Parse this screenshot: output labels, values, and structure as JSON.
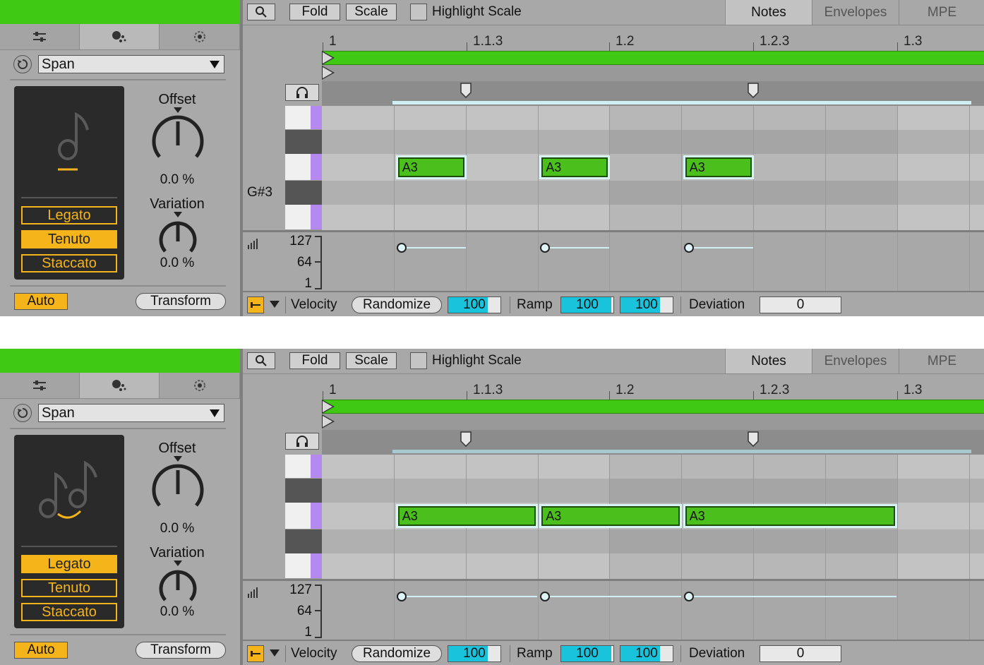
{
  "panels": [
    {
      "span_label": "Span",
      "offset": {
        "label": "Offset",
        "value": "0.0 %"
      },
      "variation": {
        "label": "Variation",
        "value": "0.0 %"
      },
      "articulation": [
        "Legato",
        "Tenuto",
        "Staccato"
      ],
      "active_articulation": "Tenuto",
      "mode": "tenuto",
      "auto_label": "Auto",
      "transform_label": "Transform",
      "toolbar": {
        "fold": "Fold",
        "scale": "Scale",
        "highlight_scale": "Highlight Scale"
      },
      "tabs": [
        "Notes",
        "Envelopes",
        "MPE"
      ],
      "active_tab": "Notes",
      "ruler": [
        "1",
        "1.1.3",
        "1.2",
        "1.2.3",
        "1.3"
      ],
      "pitch_label": "G#3",
      "notes": [
        {
          "name": "A3",
          "start_beat": 0.5,
          "length_beats": 0.5
        },
        {
          "name": "A3",
          "start_beat": 1.5,
          "length_beats": 0.5
        },
        {
          "name": "A3",
          "start_beat": 2.5,
          "length_beats": 0.5
        }
      ],
      "velocity_scale": [
        "127",
        "64",
        "1"
      ],
      "velocity_values": [
        127,
        127,
        127
      ],
      "bottom": {
        "velocity": "Velocity",
        "randomize": "Randomize",
        "velocity_value": "100",
        "ramp": "Ramp",
        "ramp_start": "100",
        "ramp_end": "100",
        "deviation": "Deviation",
        "deviation_value": "0"
      }
    },
    {
      "span_label": "Span",
      "offset": {
        "label": "Offset",
        "value": "0.0 %"
      },
      "variation": {
        "label": "Variation",
        "value": "0.0 %"
      },
      "articulation": [
        "Legato",
        "Tenuto",
        "Staccato"
      ],
      "active_articulation": "Legato",
      "mode": "legato",
      "auto_label": "Auto",
      "transform_label": "Transform",
      "toolbar": {
        "fold": "Fold",
        "scale": "Scale",
        "highlight_scale": "Highlight Scale"
      },
      "tabs": [
        "Notes",
        "Envelopes",
        "MPE"
      ],
      "active_tab": "Notes",
      "ruler": [
        "1",
        "1.1.3",
        "1.2",
        "1.2.3",
        "1.3"
      ],
      "pitch_label": "",
      "notes": [
        {
          "name": "A3",
          "start_beat": 0.5,
          "length_beats": 1.0
        },
        {
          "name": "A3",
          "start_beat": 1.5,
          "length_beats": 1.0
        },
        {
          "name": "A3",
          "start_beat": 2.5,
          "length_beats": 1.5
        }
      ],
      "velocity_scale": [
        "127",
        "64",
        "1"
      ],
      "velocity_values": [
        127,
        127,
        127
      ],
      "bottom": {
        "velocity": "Velocity",
        "randomize": "Randomize",
        "velocity_value": "100",
        "ramp": "Ramp",
        "ramp_start": "100",
        "ramp_end": "100",
        "deviation": "Deviation",
        "deviation_value": "0"
      }
    }
  ],
  "colors": {
    "clip_green": "#3fc814",
    "accent_orange": "#f5b419",
    "note_green": "#4bbf1c",
    "velocity_cyan": "#19c3dc",
    "key_purple": "#b58af0"
  },
  "icons": [
    "search-icon",
    "mixer-sliders-icon",
    "dice-icon",
    "target-icon",
    "reset-icon",
    "dropdown-arrow-icon",
    "headphones-icon",
    "velocity-bars-icon",
    "fold-toggle-icon"
  ]
}
